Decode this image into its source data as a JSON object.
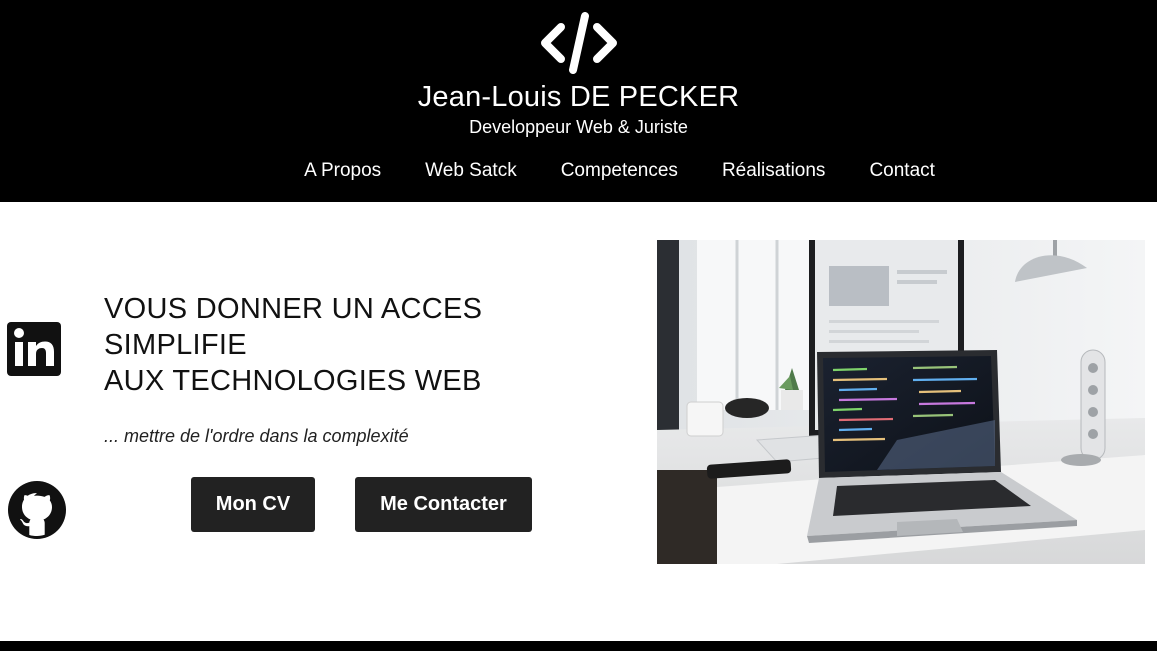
{
  "header": {
    "logo_icon": "code-brackets-icon",
    "title": "Jean-Louis DE PECKER",
    "subtitle": "Developpeur Web & Juriste",
    "nav": [
      {
        "label": "A Propos"
      },
      {
        "label": "Web Satck"
      },
      {
        "label": "Competences"
      },
      {
        "label": "Réalisations"
      },
      {
        "label": "Contact"
      }
    ]
  },
  "social": {
    "linkedin_icon": "linkedin-icon",
    "github_icon": "github-icon"
  },
  "hero": {
    "heading_lines": [
      "VOUS DONNER UN ACCES",
      "SIMPLIFIE",
      "AUX TECHNOLOGIES WEB"
    ],
    "tagline": "... mettre de l'ordre dans la complexité",
    "cv_button": "Mon CV",
    "contact_button": "Me Contacter",
    "image_icon": "laptop-workspace-photo"
  },
  "colors": {
    "header_bg": "#000000",
    "button_bg": "#222222",
    "text": "#111111"
  }
}
